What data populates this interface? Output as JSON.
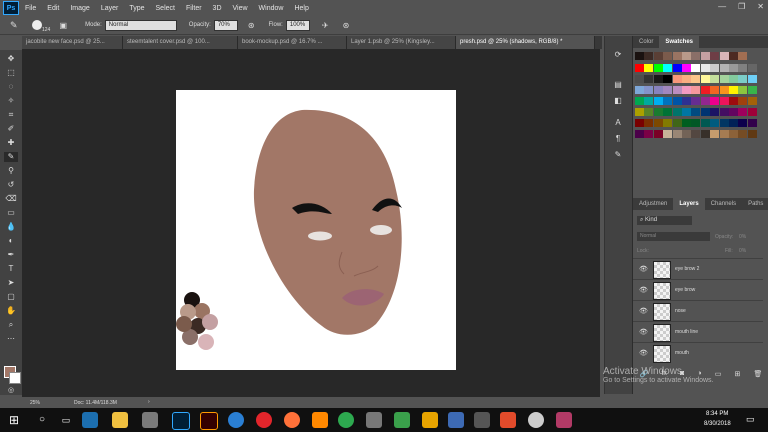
{
  "app": {
    "logo": "Ps"
  },
  "menu": [
    "File",
    "Edit",
    "Image",
    "Layer",
    "Type",
    "Select",
    "Filter",
    "3D",
    "View",
    "Window",
    "Help"
  ],
  "options": {
    "brush_size": "124",
    "mode_label": "Mode:",
    "mode_value": "Normal",
    "opacity_label": "Opacity:",
    "opacity_value": "70%",
    "flow_label": "Flow:",
    "flow_value": "100%"
  },
  "tabs": [
    "jacobite new face.psd @ 25...",
    "steemtalent cover.psd @ 100...",
    "book-mockup.psd @ 16.7% ...",
    "Layer 1.psb @ 25% (Kingsley...",
    "presh.psd @ 25% (shadows, RGB/8) *"
  ],
  "colors": {
    "skin": "#a27767",
    "brow": "#111111",
    "lip": "#9c6473",
    "accent": "#31a8ff"
  },
  "palette": [
    "#1a1210",
    "#3b2a24",
    "#5a3f35",
    "#7b5b4c",
    "#9a7462",
    "#b99a8a",
    "#8a6f68",
    "#c4a0a2",
    "#6e3e46",
    "#d9b4b8",
    "#4d2a22",
    "#a16e52"
  ],
  "right_panel": {
    "tabs_top": [
      "Color",
      "Swatches"
    ],
    "tabs_layers": [
      "Adjustmen",
      "Layers",
      "Channels",
      "Paths"
    ],
    "kind": "Kind",
    "blend": "Normal",
    "opacity_label": "Opacity:",
    "opacity_value": "0%",
    "lock": "Lock:",
    "fill_label": "Fill:",
    "fill_value": "0%",
    "layers": [
      "eye brow 2",
      "eye brow",
      "nose",
      "mouth line",
      "mouth"
    ]
  },
  "status": {
    "zoom": "25%",
    "doc": "Doc: 11.4M/118.3M"
  },
  "watermark": {
    "line1": "Activate Windows",
    "line2": "Go to Settings to activate Windows."
  },
  "clock": {
    "time": "8:34 PM",
    "date": "8/30/2018"
  }
}
